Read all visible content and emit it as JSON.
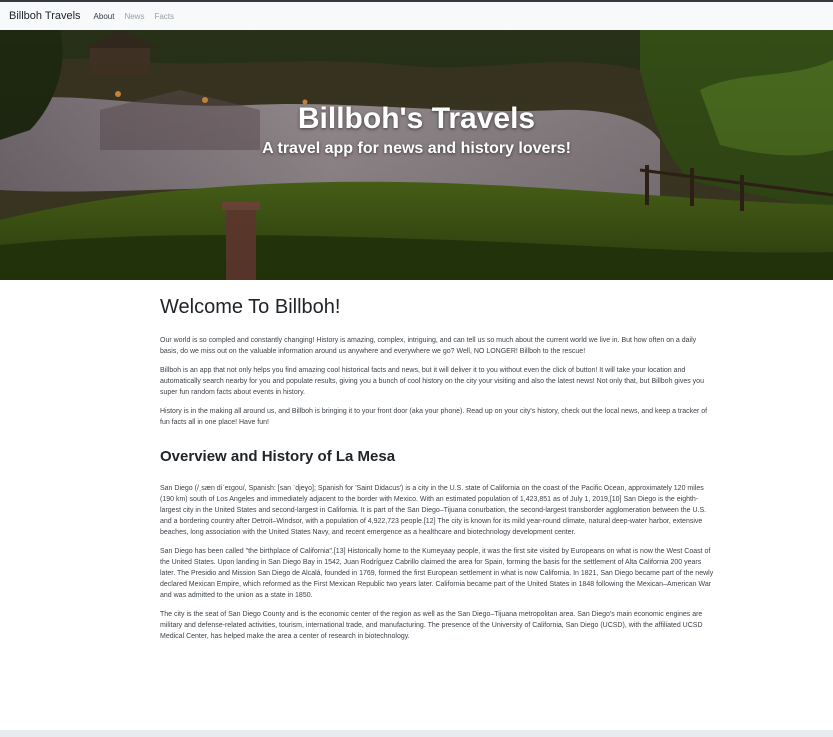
{
  "navbar": {
    "brand": "Billboh Travels",
    "links": [
      {
        "label": "About"
      },
      {
        "label": "News"
      },
      {
        "label": "Facts"
      }
    ]
  },
  "hero": {
    "title": "Billboh's Travels",
    "subtitle": "A travel app for news and history lovers!"
  },
  "welcome": {
    "title": "Welcome To Billboh!",
    "paragraphs": [
      "Our world is so compled and constantly changing! History is amazing, complex, intriguing, and can tell us so much about the current world we live in. But how often on a daily basis, do we miss out on the valuable information around us anywhere and everywhere we go? Well, NO LONGER! Billboh to the rescue!",
      "Billboh is an app that not only helps you find amazing cool historical facts and news, but it will deliver it to you without even the click of button! It will take your location and automatically search nearby for you and populate results, giving you a bunch of cool history on the city your visiting and also the latest news! Not only that, but Billboh gives you super fun random facts about events in history.",
      "History is in the making all around us, and Billboh is bringing it to your front door (aka your phone). Read up on your city's history, check out the local news, and keep a tracker of fun facts all in one place! Have fun!"
    ]
  },
  "overview": {
    "title": "Overview and History of La Mesa",
    "paragraphs": [
      "San Diego (/ˌsæn diˈeɪɡoʊ/, Spanish: [san ˈdjeɣo]; Spanish for 'Saint Didacus') is a city in the U.S. state of California on the coast of the Pacific Ocean, approximately 120 miles (190 km) south of Los Angeles and immediately adjacent to the border with Mexico. With an estimated population of 1,423,851 as of July 1, 2019,[10] San Diego is the eighth-largest city in the United States and second-largest in California. It is part of the San Diego–Tijuana conurbation, the second-largest transborder agglomeration between the U.S. and a bordering country after Detroit–Windsor, with a population of 4,922,723 people.[12] The city is known for its mild year-round climate, natural deep-water harbor, extensive beaches, long association with the United States Navy, and recent emergence as a healthcare and biotechnology development center.",
      "San Diego has been called \"the birthplace of California\".[13] Historically home to the Kumeyaay people, it was the first site visited by Europeans on what is now the West Coast of the United States. Upon landing in San Diego Bay in 1542, Juan Rodríguez Cabrillo claimed the area for Spain, forming the basis for the settlement of Alta California 200 years later. The Presidio and Mission San Diego de Alcalá, founded in 1769, formed the first European settlement in what is now California. In 1821, San Diego became part of the newly declared Mexican Empire, which reformed as the First Mexican Republic two years later. California became part of the United States in 1848 following the Mexican–American War and was admitted to the union as a state in 1850.",
      "The city is the seat of San Diego County and is the economic center of the region as well as the San Diego–Tijuana metropolitan area. San Diego's main economic engines are military and defense-related activities, tourism, international trade, and manufacturing. The presence of the University of California, San Diego (UCSD), with the affiliated UCSD Medical Center, has helped make the area a center of research in biotechnology."
    ]
  }
}
